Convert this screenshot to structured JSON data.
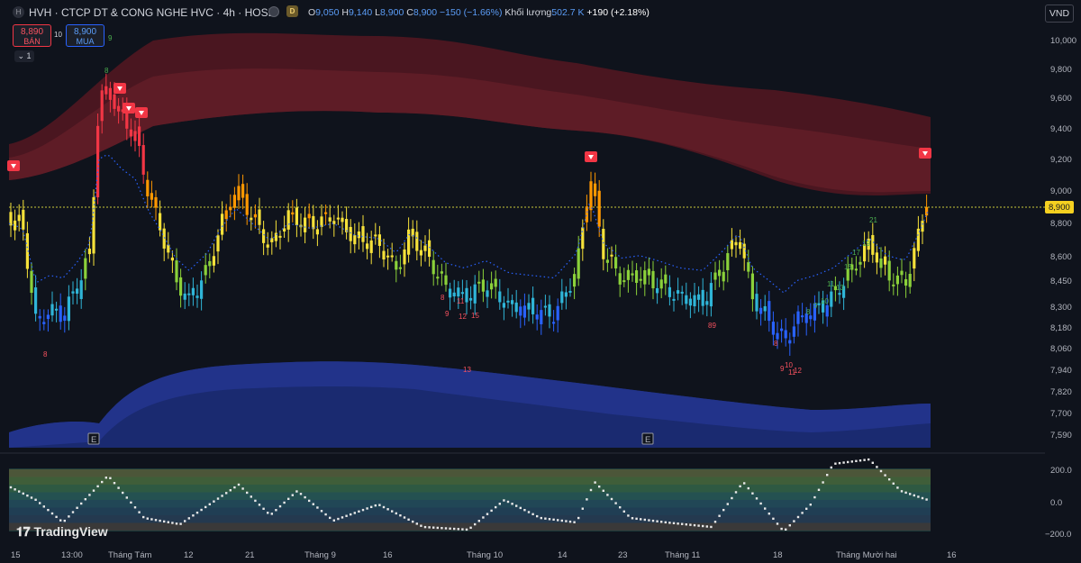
{
  "header": {
    "symbol_title": "HVH · CTCP DT & CONG NGHE HVC · 4h · HOSE",
    "interval_badge": "D",
    "open_label": "O",
    "open": "9,050",
    "high_label": "H",
    "high": "9,140",
    "low_label": "L",
    "low": "8,900",
    "close_label": "C",
    "close": "8,900",
    "change": "−150 (−1.66%)",
    "volume_label": "Khối lượng",
    "volume": "502.7 K",
    "extra_change": "+190 (+2.18%)",
    "currency": "VND"
  },
  "trade": {
    "sell_price": "8,890",
    "sell_label": "BÁN",
    "spread": "10",
    "buy_price": "8,900",
    "buy_label": "MUA"
  },
  "indicators_toggle": "1",
  "price_axis": [
    "10,000",
    "9,800",
    "9,600",
    "9,400",
    "9,200",
    "9,000",
    "8,800",
    "8,600",
    "8,450",
    "8,300",
    "8,180",
    "8,060",
    "7,940",
    "7,820",
    "7,700",
    "7,590"
  ],
  "current_price": "8,900",
  "osc_axis": [
    "200.0",
    "0.0",
    "−200.0"
  ],
  "time_axis": [
    "15",
    "13:00",
    "Tháng Tám",
    "12",
    "21",
    "Tháng 9",
    "16",
    "Tháng 10",
    "14",
    "23",
    "Tháng 11",
    "18",
    "Tháng Mười hai",
    "16"
  ],
  "earnings_marker": "E",
  "brand": "TradingView",
  "colors": {
    "bg": "#0f131c",
    "upper_band": "#5a1a22",
    "lower_band": "#1c2f7a",
    "price_line": "#c8c83a",
    "current_price_bg": "#f5d020"
  },
  "chart_data": {
    "type": "candlestick",
    "symbol": "HVH",
    "interval": "4h",
    "last_price": 8900,
    "sell_signals": 6,
    "counter_labels_red": [
      "8",
      "9",
      "8",
      "11",
      "12",
      "15",
      "13",
      "89",
      "8",
      "9",
      "10",
      "11",
      "12"
    ],
    "counter_labels_green": [
      "9",
      "8",
      "21",
      "19",
      "17",
      "15",
      "11",
      "13",
      "10",
      "9",
      "8"
    ]
  }
}
